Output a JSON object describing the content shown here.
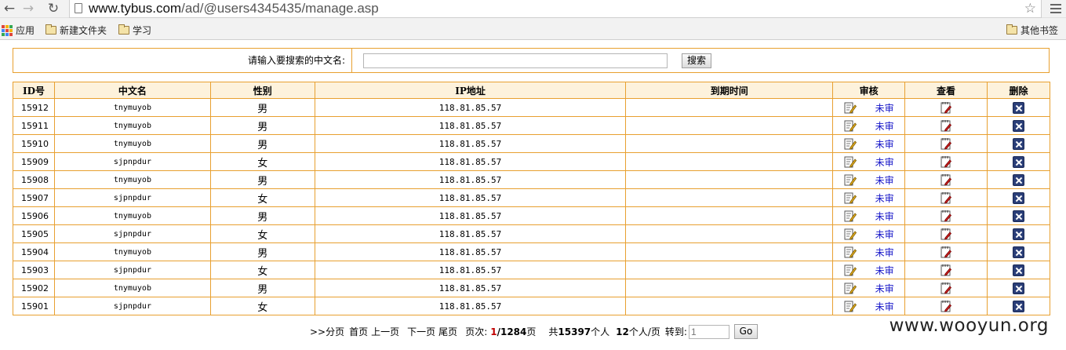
{
  "browser": {
    "url_host": "www.tybus.com",
    "url_path": "/ad/@users4345435/manage.asp",
    "bookmarks": [
      {
        "label": "应用",
        "icon": "apps-icon"
      },
      {
        "label": "新建文件夹",
        "icon": "folder-icon"
      },
      {
        "label": "学习",
        "icon": "folder-icon"
      }
    ],
    "other_bookmarks": "其他书签"
  },
  "search": {
    "label": "请输入要搜索的中文名:",
    "value": "",
    "button": "搜索"
  },
  "table": {
    "headers": [
      "ID号",
      "中文名",
      "性别",
      "IP地址",
      "到期时间",
      "审核",
      "查看",
      "删除"
    ],
    "rows": [
      {
        "id": "15912",
        "name": "tnymuyob",
        "gender": "男",
        "ip": "118.81.85.57",
        "expiry": "",
        "review": "未审"
      },
      {
        "id": "15911",
        "name": "tnymuyob",
        "gender": "男",
        "ip": "118.81.85.57",
        "expiry": "",
        "review": "未审"
      },
      {
        "id": "15910",
        "name": "tnymuyob",
        "gender": "男",
        "ip": "118.81.85.57",
        "expiry": "",
        "review": "未审"
      },
      {
        "id": "15909",
        "name": "sjpnpdur",
        "gender": "女",
        "ip": "118.81.85.57",
        "expiry": "",
        "review": "未审"
      },
      {
        "id": "15908",
        "name": "tnymuyob",
        "gender": "男",
        "ip": "118.81.85.57",
        "expiry": "",
        "review": "未审"
      },
      {
        "id": "15907",
        "name": "sjpnpdur",
        "gender": "女",
        "ip": "118.81.85.57",
        "expiry": "",
        "review": "未审"
      },
      {
        "id": "15906",
        "name": "tnymuyob",
        "gender": "男",
        "ip": "118.81.85.57",
        "expiry": "",
        "review": "未审"
      },
      {
        "id": "15905",
        "name": "sjpnpdur",
        "gender": "女",
        "ip": "118.81.85.57",
        "expiry": "",
        "review": "未审"
      },
      {
        "id": "15904",
        "name": "tnymuyob",
        "gender": "男",
        "ip": "118.81.85.57",
        "expiry": "",
        "review": "未审"
      },
      {
        "id": "15903",
        "name": "sjpnpdur",
        "gender": "女",
        "ip": "118.81.85.57",
        "expiry": "",
        "review": "未审"
      },
      {
        "id": "15902",
        "name": "tnymuyob",
        "gender": "男",
        "ip": "118.81.85.57",
        "expiry": "",
        "review": "未审"
      },
      {
        "id": "15901",
        "name": "sjpnpdur",
        "gender": "女",
        "ip": "118.81.85.57",
        "expiry": "",
        "review": "未审"
      }
    ]
  },
  "pager": {
    "prefix": ">>分页",
    "first": "首页",
    "prev": "上一页",
    "next": "下一页",
    "last": "尾页",
    "page_label": "页次:",
    "current_page": "1",
    "total_pages": "/1284",
    "page_suffix": "页",
    "total_prefix": "共",
    "total_count": "15397",
    "total_suffix": "个人",
    "per_page": "12",
    "per_page_suffix": "个人/页",
    "goto_label": "转到:",
    "goto_value": "1",
    "go_button": "Go"
  },
  "watermark": "www.wooyun.org",
  "colors": {
    "border": "#e8a030",
    "header_bg": "#fdf2dc",
    "link": "#1616c8",
    "current_page": "#c00000",
    "delete_icon": "#2a3e78"
  }
}
